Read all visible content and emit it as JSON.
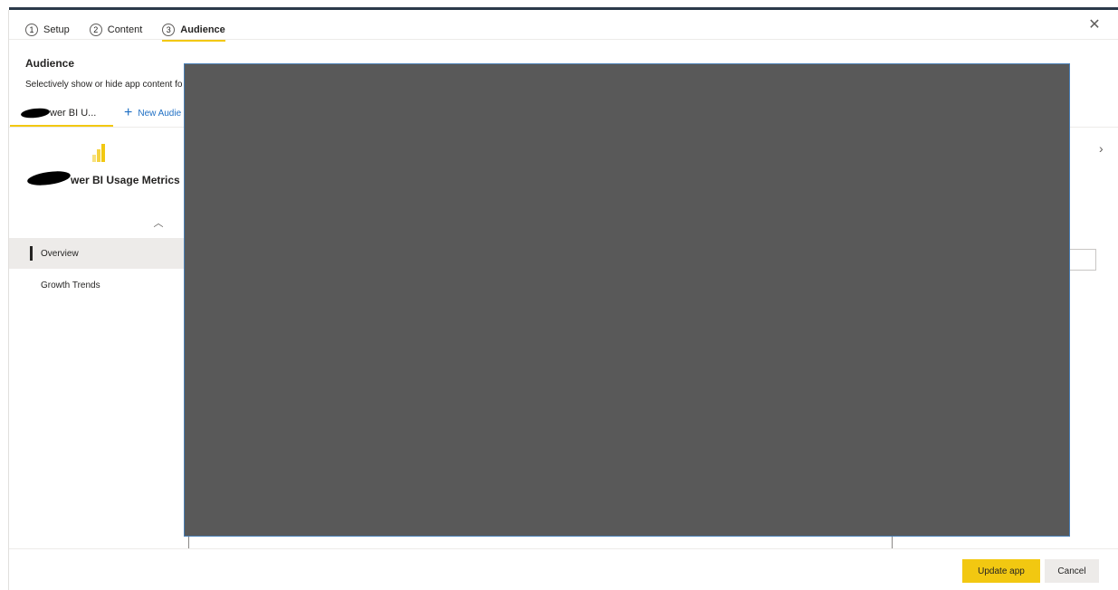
{
  "stepper": {
    "steps": [
      {
        "number": "1",
        "label": "Setup"
      },
      {
        "number": "2",
        "label": "Content"
      },
      {
        "number": "3",
        "label": "Audience"
      }
    ],
    "active": "Audience"
  },
  "header": {
    "title": "Audience",
    "description": "Selectively show or hide app content fo"
  },
  "audience_tabs": {
    "active_tab_label": "wer BI U...",
    "new_audience_label": "New Audie"
  },
  "app": {
    "name": "wer BI Usage Metrics"
  },
  "nav": {
    "items": [
      {
        "label": "Overview",
        "selected": true
      },
      {
        "label": "Growth Trends",
        "selected": false
      }
    ]
  },
  "footer": {
    "update_label": "Update app",
    "cancel_label": "Cancel"
  },
  "colors": {
    "accent": "#f2c811",
    "link": "#1f6fc4",
    "overlay": "#595959"
  },
  "icons": {
    "close": "close-icon",
    "chevron_up": "chevron-up-icon",
    "chevron_right": "chevron-right-icon",
    "plus": "plus-icon",
    "app_logo": "powerbi-logo-icon"
  }
}
